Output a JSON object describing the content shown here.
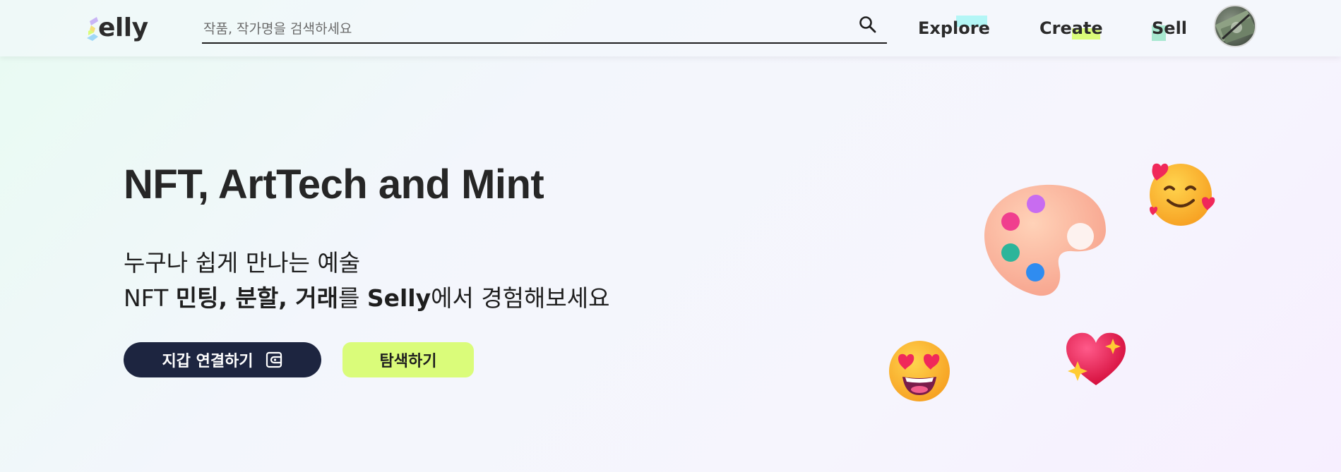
{
  "header": {
    "logo_text": "elly",
    "search": {
      "placeholder": "작품, 작가명을 검색하세요",
      "value": ""
    },
    "nav": {
      "explore": "Explore",
      "create": "Create",
      "sell": "Sell"
    },
    "colors": {
      "explore_highlight": "#b3f6f6",
      "create_highlight": "#dafc7a",
      "sell_highlight": "#a8e8d0"
    }
  },
  "hero": {
    "title": "NFT, ArtTech and Mint",
    "line1": "누구나 쉽게 만나는 예술",
    "line2_parts": {
      "a": "NFT ",
      "b": "민팅, 분할, 거래",
      "c": "를 ",
      "d": "Selly",
      "e": "에서 경험해보세요"
    },
    "wallet_button": "지갑 연결하기",
    "explore_button": "탐색하기"
  },
  "icons": {
    "search": "search-icon",
    "wallet": "wallet-icon",
    "palette": "palette-emoji",
    "smile": "smiling-face-with-hearts-emoji",
    "heart_eyes": "heart-eyes-emoji",
    "sparkling_heart": "sparkling-heart-emoji"
  },
  "colors": {
    "wallet_button_bg": "#1d2540",
    "explore_button_bg": "#dafc7a"
  }
}
